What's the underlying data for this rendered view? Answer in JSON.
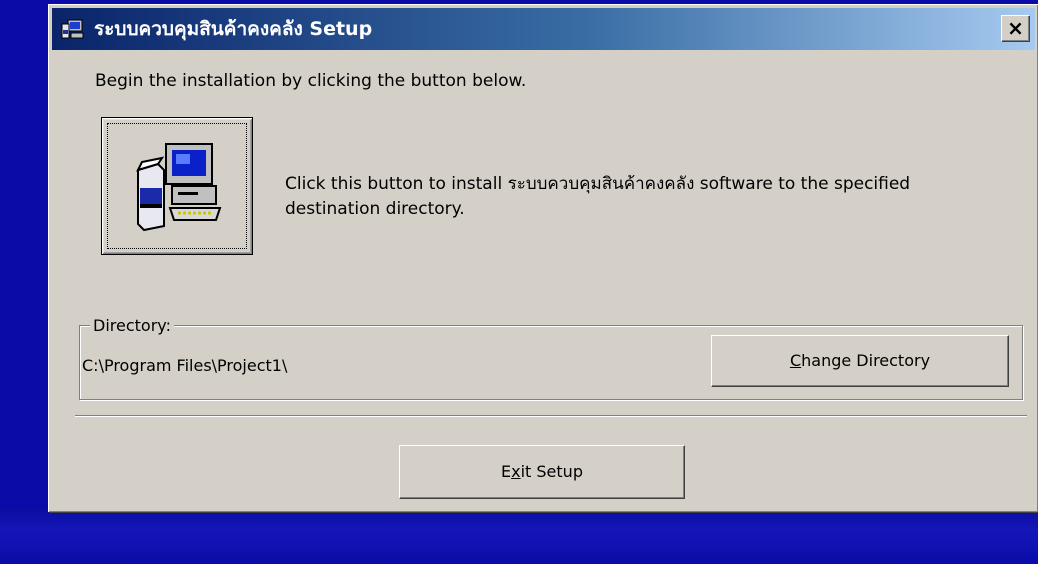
{
  "window": {
    "title": "ระบบควบคุมสินค้าคงคลัง Setup",
    "close_symbol": "×",
    "icon": "setup-computer-icon"
  },
  "intro_text": "Begin the installation by clicking the button below.",
  "install": {
    "icon": "install-computer-icon",
    "description": "Click this button to install ระบบควบคุมสินค้าคงคลัง software to the specified destination directory."
  },
  "directory": {
    "legend": "Directory:",
    "path": "C:\\Program Files\\Project1\\",
    "change_button": {
      "prefix": "",
      "accel": "C",
      "rest": "hange Directory"
    }
  },
  "exit_button": {
    "prefix": "E",
    "accel": "x",
    "rest": "it Setup"
  },
  "colors": {
    "desktop": "#0a0ca8",
    "titlebar_start": "#0a246a",
    "titlebar_end": "#a6caf0",
    "face": "#d4d0c8"
  }
}
